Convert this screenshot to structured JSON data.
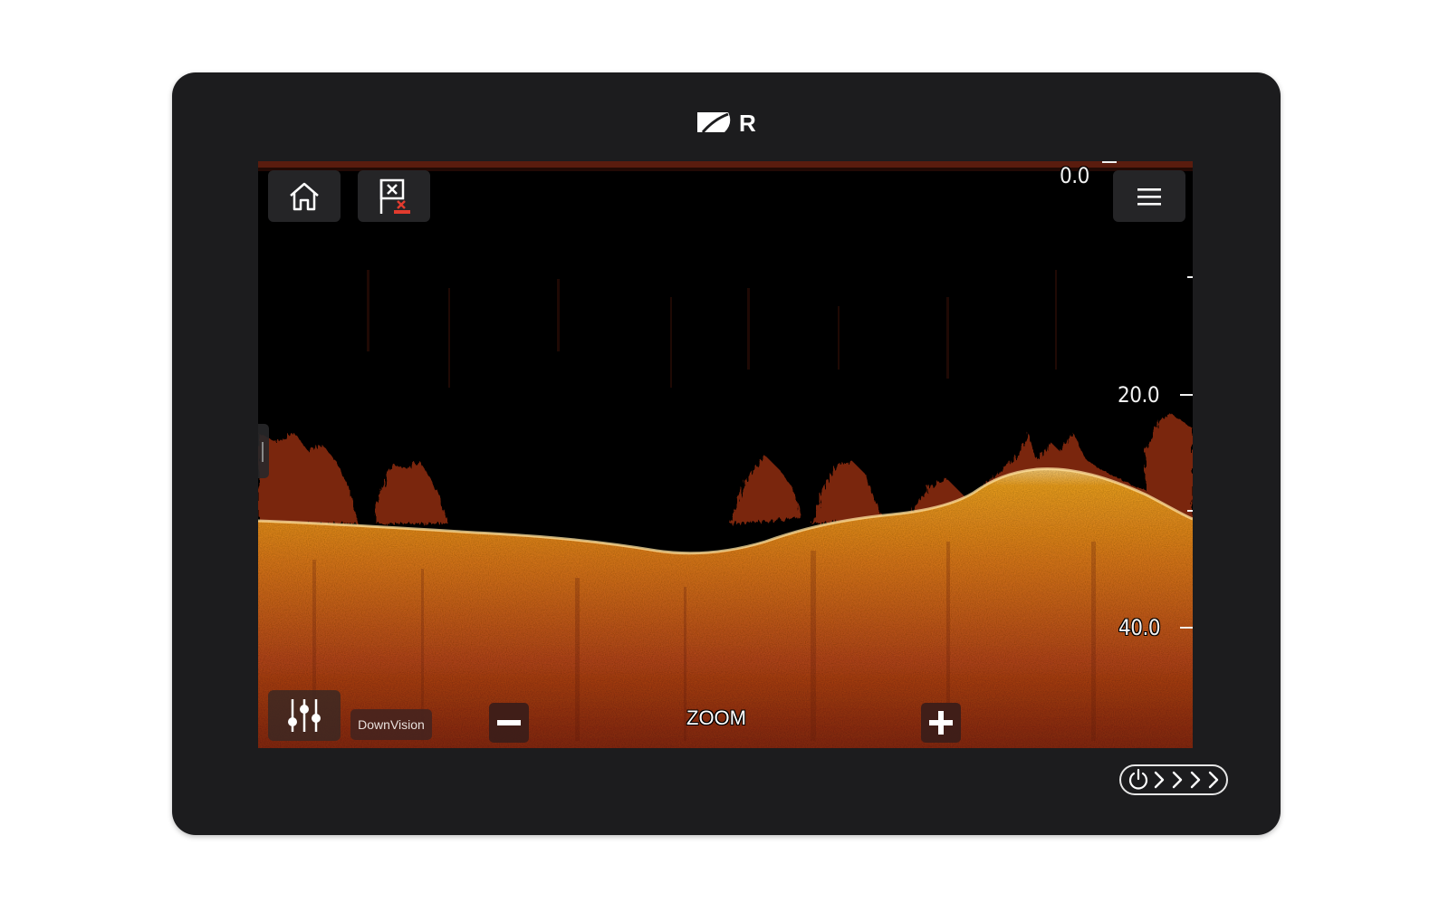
{
  "device": {
    "brand_logo": "raymarine-logo",
    "power_key_icon": "power-icon",
    "swipe_arrows": [
      "›",
      "›",
      "›",
      "›"
    ]
  },
  "toolbar": {
    "home_icon": "home-icon",
    "waypoint_icon": "waypoint-flag-icon",
    "menu_icon": "hamburger-menu-icon"
  },
  "depth_scale": {
    "labels": [
      "0.0",
      "20.0",
      "40.0"
    ]
  },
  "controls": {
    "settings_icon": "sliders-icon",
    "mode_label": "DownVision",
    "zoom_label": "ZOOM",
    "zoom_out_icon": "minus-icon",
    "zoom_in_icon": "plus-icon"
  },
  "colors": {
    "bottom_bright": "#f5a623",
    "bottom_mid": "#d9701a",
    "bottom_dark": "#9a3a12",
    "clutter": "#7a2510"
  }
}
